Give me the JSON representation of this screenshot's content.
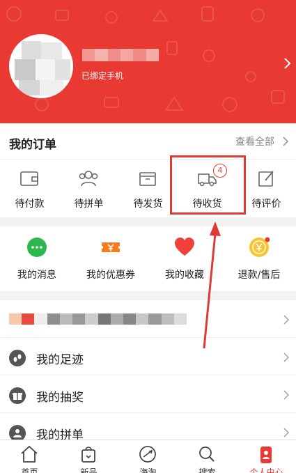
{
  "profile": {
    "phone_status": "已绑定手机"
  },
  "orders": {
    "title": "我的订单",
    "view_all": "查看全部",
    "items": [
      {
        "label": "待付款",
        "icon": "wallet-icon"
      },
      {
        "label": "待拼单",
        "icon": "group-icon"
      },
      {
        "label": "待发货",
        "icon": "box-icon"
      },
      {
        "label": "待收货",
        "icon": "truck-icon",
        "badge": "4"
      },
      {
        "label": "待评价",
        "icon": "edit-icon"
      }
    ]
  },
  "services": {
    "items": [
      {
        "label": "我的消息",
        "icon": "message-icon"
      },
      {
        "label": "我的优惠券",
        "icon": "coupon-icon"
      },
      {
        "label": "我的收藏",
        "icon": "heart-icon"
      },
      {
        "label": "退款/售后",
        "icon": "refund-coin-icon"
      }
    ]
  },
  "menu": {
    "items": [
      {
        "label": "我的足迹",
        "icon": "footprint-icon"
      },
      {
        "label": "我的抽奖",
        "icon": "gift-icon"
      },
      {
        "label": "我的拼单",
        "icon": "group-order-icon"
      }
    ]
  },
  "tabbar": {
    "items": [
      {
        "label": "首页",
        "icon": "home-icon"
      },
      {
        "label": "新品",
        "icon": "new-bag-icon"
      },
      {
        "label": "海淘",
        "icon": "plane-globe-icon"
      },
      {
        "label": "搜索",
        "icon": "search-icon"
      },
      {
        "label": "个人中心",
        "icon": "profile-icon",
        "active": true
      }
    ]
  },
  "colors": {
    "brand_red": "#e83a33",
    "highlight_box": "#e03a33",
    "message_green": "#2db84d",
    "coupon_orange": "#f57c1f",
    "heart_red": "#f0413b",
    "coin_yellow": "#f7c531"
  }
}
